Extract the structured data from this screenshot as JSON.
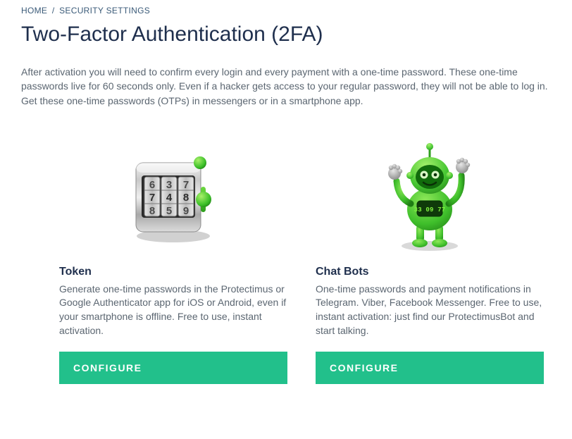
{
  "breadcrumb": {
    "home": "HOME",
    "sep": "/",
    "current": "SECURITY SETTINGS"
  },
  "page_title": "Two-Factor Authentication (2FA)",
  "intro_text": "After activation you will need to confirm every login and every payment with a one-time password. These one-time passwords live for 60 seconds only. Even if a hacker gets access to your regular password, they will not be able to log in. Get these one-time passwords (OTPs) in messengers or in a smartphone app.",
  "cards": {
    "token": {
      "title": "Token",
      "desc": "Generate one-time passwords in the Protectimus or Google Authenticator app for iOS or Android, even if your smartphone is offline. Free to use, instant activation.",
      "button": "CONFIGURE"
    },
    "chatbots": {
      "title": "Chat Bots",
      "desc": "One-time passwords and payment notifications in Telegram. Viber, Facebook Messenger. Free to use, instant activation: just find our ProtectimusBot and start talking.",
      "button": "CONFIGURE",
      "display_code": "33 09 77"
    }
  },
  "colors": {
    "accent": "#22c08b",
    "heading": "#1f2f4d",
    "body": "#5b6671"
  }
}
